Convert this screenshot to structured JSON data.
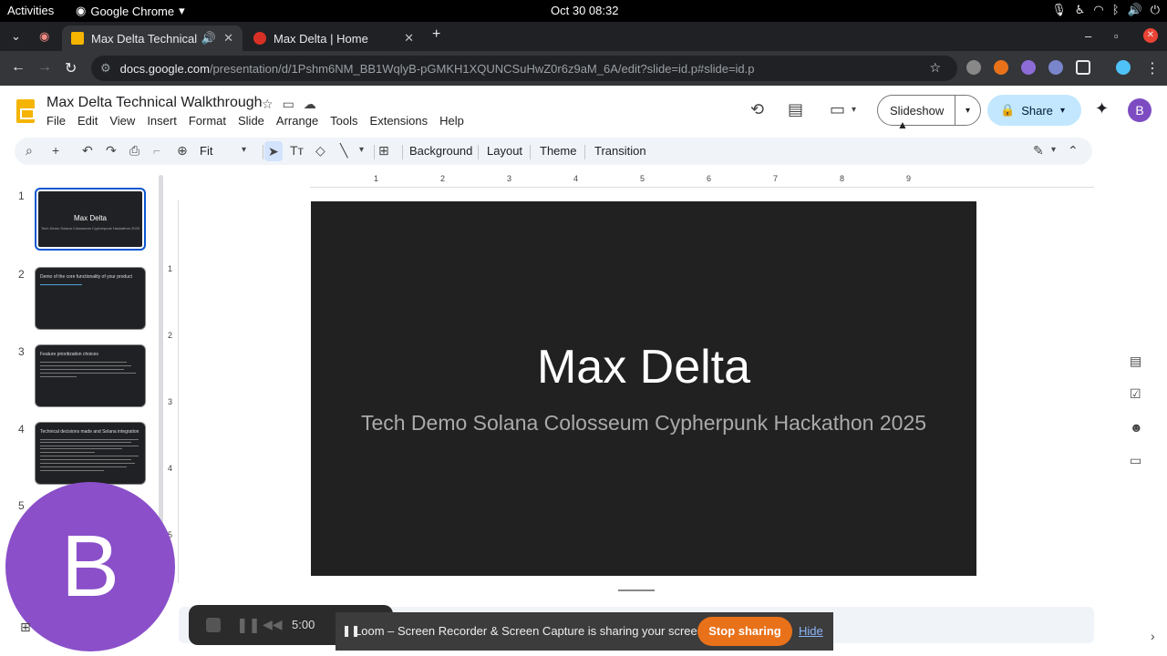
{
  "os": {
    "activities": "Activities",
    "app_name": "Google Chrome",
    "clock": "Oct 30  08:32"
  },
  "tabs": [
    {
      "title": "Max Delta Technical W",
      "favicon_color": "#f4b400"
    },
    {
      "title": "Max Delta | Home",
      "favicon_color": "#d93025"
    }
  ],
  "address": {
    "host": "docs.google.com",
    "path": "/presentation/d/1Pshm6NM_BB1WqlyB-pGMKH1XQUNCSuHwZ0r6z9aM_6A/edit?slide=id.p#slide=id.p"
  },
  "doc": {
    "title": "Max Delta Technical Walkthrough",
    "menus": [
      "File",
      "Edit",
      "View",
      "Insert",
      "Format",
      "Slide",
      "Arrange",
      "Tools",
      "Extensions",
      "Help"
    ],
    "slideshow_label": "Slideshow",
    "share_label": "Share",
    "user_initial": "B"
  },
  "toolbar": {
    "zoom": "Fit",
    "background": "Background",
    "layout": "Layout",
    "theme": "Theme",
    "transition": "Transition"
  },
  "filmstrip": {
    "numbers": [
      "1",
      "2",
      "3",
      "4",
      "5"
    ],
    "slide1_title": "Max Delta",
    "slide1_sub": "Tech Demo Solana Colosseum Cypherpunk Hackathon 2025",
    "slide2_title": "Demo of the core functionality of your product",
    "slide3_title": "Feature prioritization choices",
    "slide4_title": "Technical decisions made and Solana integration"
  },
  "ruler": {
    "h_ticks": [
      "1",
      "2",
      "3",
      "4",
      "5",
      "6",
      "7",
      "8",
      "9"
    ],
    "v_ticks": [
      "1",
      "2",
      "3",
      "4",
      "5"
    ]
  },
  "slide": {
    "title": "Max Delta",
    "subtitle": "Tech Demo Solana Colosseum Cypherpunk Hackathon 2025"
  },
  "loom": {
    "avatar_initial": "B",
    "timer": "5:00",
    "share_message": "Loom – Screen Recorder & Screen Capture is sharing your screen.",
    "stop_label": "Stop sharing",
    "hide_label": "Hide"
  }
}
